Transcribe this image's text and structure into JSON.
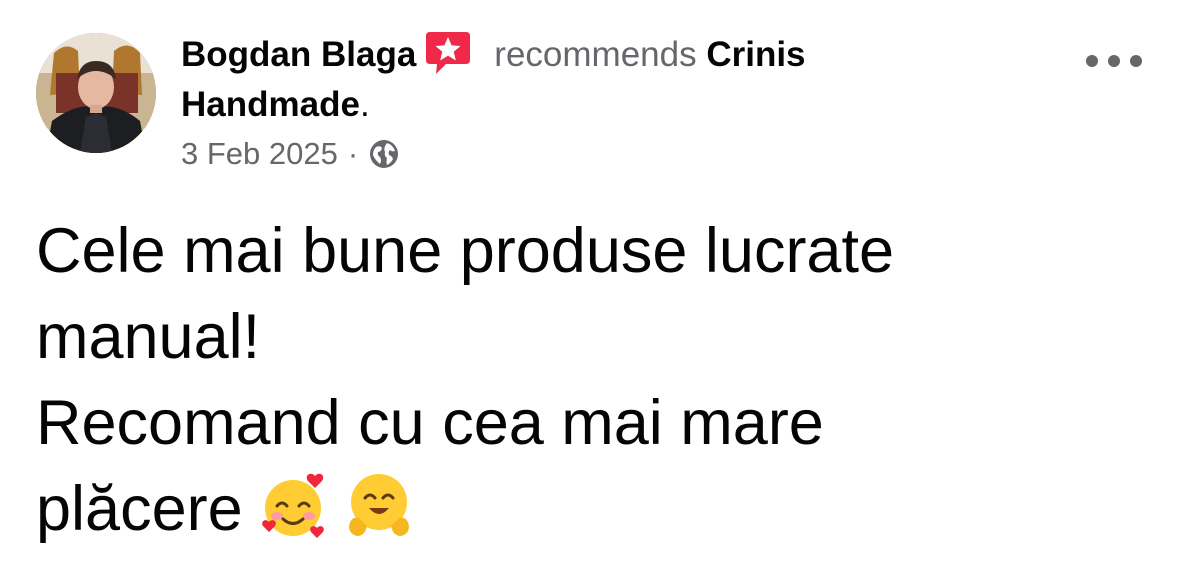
{
  "post": {
    "author": {
      "name": "Bogdan Blaga",
      "avatar_icon": "profile-photo",
      "badge_icon": "recommendation-star-icon"
    },
    "action": "recommends",
    "page_line1": "Crinis",
    "page_line2": "Handmade",
    "period": ".",
    "date": "3 Feb 2025",
    "separator": "·",
    "audience_icon": "globe-icon",
    "more_icon": "more-options-icon",
    "body_lines": [
      "Cele mai bune produse lucrate",
      "manual!",
      "Recomand cu cea mai mare",
      "plăcere"
    ],
    "emojis": [
      "smiling-face-with-hearts",
      "hugging-face"
    ]
  },
  "colors": {
    "primary_text": "#050505",
    "secondary_text": "#65676b",
    "badge_pink": "#f02849",
    "emoji_yellow": "#ffcc33"
  }
}
